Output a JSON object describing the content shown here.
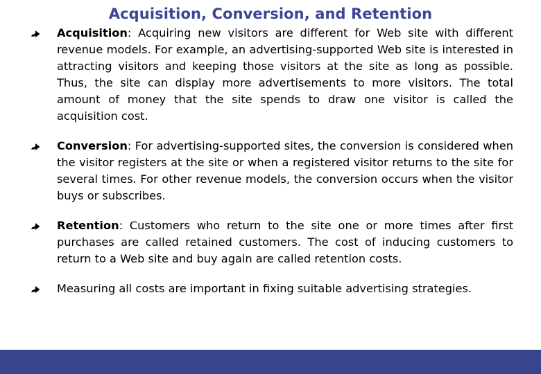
{
  "slide": {
    "title": "Acquisition, Conversion, and Retention",
    "title_color": "#3a4596",
    "background_color": "#ffffff",
    "footer_bar_color": "#37458c",
    "bullet_icon": "zigzag-arrow-bullet-icon",
    "bullets": [
      {
        "term": "Acquisition",
        "separator": ": ",
        "text": "Acquiring new visitors are different for Web site with different revenue models. For example, an advertising-supported Web site is interested in attracting visitors and keeping those visitors at the site as long as possible. Thus, the site can display more advertisements to more visitors. The total amount of money that the site spends to draw one visitor is called the acquisition cost."
      },
      {
        "term": "Conversion",
        "separator": ": ",
        "text": "For advertising-supported sites, the conversion is considered when the visitor registers at the site or when a registered visitor returns to the site for several times. For other revenue models, the conversion occurs when the visitor buys or subscribes."
      },
      {
        "term": "Retention",
        "separator": ": ",
        "text": "Customers who return to the site one or more times after first purchases are called retained customers. The cost of inducing customers to return to a Web site and buy again are called retention costs."
      },
      {
        "term": "",
        "separator": "",
        "text": "Measuring all costs are important in fixing suitable advertising strategies."
      }
    ]
  }
}
